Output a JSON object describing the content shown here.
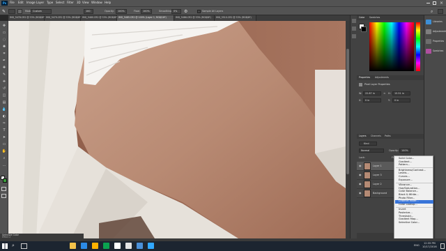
{
  "menu": {
    "app": "Ps",
    "items": [
      "File",
      "Edit",
      "Image",
      "Layer",
      "Type",
      "Select",
      "Filter",
      "3D",
      "View",
      "Window",
      "Help"
    ]
  },
  "options": {
    "mode_label": "Mode:",
    "mode_value": "Custom",
    "size_value": "100",
    "opacity_label": "Opacity:",
    "opacity_value": "100%",
    "flow_label": "Flow:",
    "flow_value": "100%",
    "smoothing_label": "Smoothing:",
    "smoothing_value": "0%",
    "sample_label": "Sample All Layers"
  },
  "tabs": [
    {
      "label": "IMG_5478.CR2 @ 33% (RGB/8*)"
    },
    {
      "label": "IMG_5479.CR2 @ 33% (RGB/8*)"
    },
    {
      "label": "IMG_5480.CR2 @ 33% (RGB/8*)"
    },
    {
      "label": "IMG_5485.CR2 @ 100% (Layer 1, RGB/16*)",
      "active": true
    },
    {
      "label": "IMG_5486.CR2 @ 33% (RGB/8*)"
    },
    {
      "label": "IMG_5510.CR2 @ 33% (RGB/8*)"
    }
  ],
  "panels": {
    "color_tab": "Color",
    "swatches_tab": "Swatches",
    "properties_tab": "Properties",
    "adjustments_tab": "Adjustments",
    "pixel_layer_props": "Pixel Layer Properties",
    "w_label": "W:",
    "w_value": "22.87 in",
    "h_label": "H:",
    "h_value": "15.51 in",
    "x_label": "X:",
    "x_value": "0 in",
    "y_label": "Y:",
    "y_value": "0 in",
    "layers_tab": "Layers",
    "channels_tab": "Channels",
    "paths_tab": "Paths",
    "kind_label": "Kind",
    "blend_mode": "Normal",
    "opacity_label": "Opacity:",
    "opacity_value": "100%",
    "lock_label": "Lock:",
    "fill_label": "Fill:",
    "fill_value": "100%"
  },
  "libraries": [
    {
      "label": "Libraries",
      "color": "#3d8fd6"
    },
    {
      "label": "Adjustments",
      "color": "#7f7f7f"
    },
    {
      "label": "Properties",
      "color": "#6e6e6e"
    },
    {
      "label": "Swatches",
      "color": "#b04fa0"
    }
  ],
  "layers": [
    {
      "name": "Layer 1",
      "selected": true
    },
    {
      "name": "Layer 3",
      "selected": false
    },
    {
      "name": "Layer 2",
      "selected": false
    },
    {
      "name": "Background",
      "selected": false
    }
  ],
  "adjust_menu": {
    "groups": [
      [
        "Solid Color...",
        "Gradient...",
        "Pattern..."
      ],
      [
        "Brightness/Contrast...",
        "Levels...",
        "Curves...",
        "Exposure..."
      ],
      [
        "Vibrance...",
        "Hue/Saturation...",
        "Color Balance...",
        "Black & White...",
        "Photo Filter...",
        "Channel Mixer...",
        "Color Lookup..."
      ],
      [
        "Invert",
        "Posterize...",
        "Threshold...",
        "Gradient Map...",
        "Selective Color..."
      ]
    ],
    "highlighted": "Channel Mixer..."
  },
  "statusbar": {
    "doc_tab": "Selective Color",
    "effect_tab": "Effect 2"
  },
  "taskbar": {
    "language": "ENG",
    "time": "12:35 PM",
    "date": "10/17/2016"
  }
}
